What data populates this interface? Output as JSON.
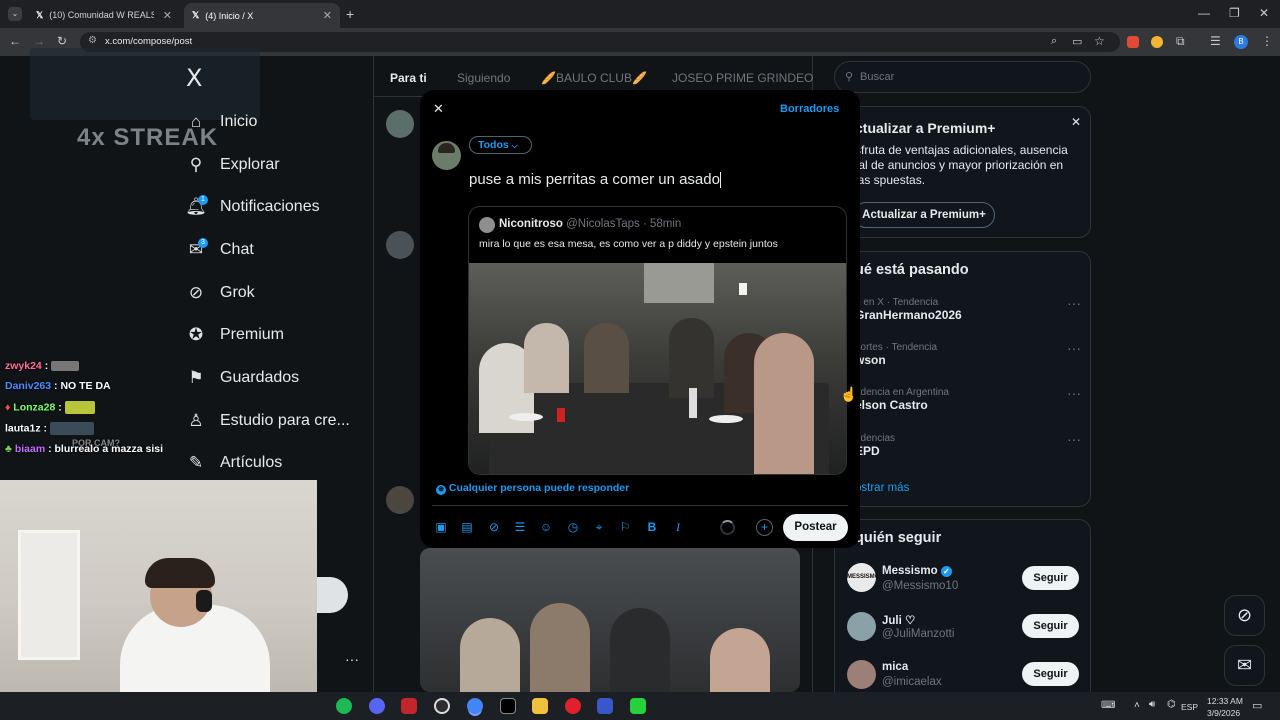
{
  "browser": {
    "tabs": [
      {
        "title": "(10) Comunidad W REALS 🔥 /",
        "active": false
      },
      {
        "title": "(4) Inicio / X",
        "active": true
      }
    ],
    "url": "x.com/compose/post",
    "profile_letter": "B"
  },
  "sidebar": {
    "logo": "X",
    "items": [
      {
        "label": "Inicio",
        "icon": "home-icon"
      },
      {
        "label": "Explorar",
        "icon": "search-icon"
      },
      {
        "label": "Notificaciones",
        "icon": "bell-icon",
        "badge": "1"
      },
      {
        "label": "Chat",
        "icon": "mail-icon",
        "badge": "3"
      },
      {
        "label": "Grok",
        "icon": "grok-icon"
      },
      {
        "label": "Premium",
        "icon": "verified-icon"
      },
      {
        "label": "Guardados",
        "icon": "bookmark-icon"
      },
      {
        "label": "Estudio para cre...",
        "icon": "studio-icon"
      },
      {
        "label": "Artículos",
        "icon": "article-icon"
      }
    ],
    "more_dots": "···"
  },
  "feed": {
    "tabs": [
      "Para ti",
      "Siguiendo",
      "🥖BAULO CLUB🥖",
      "JOSEO PRIME GRINDEO"
    ]
  },
  "right": {
    "search_placeholder": "Buscar",
    "premium": {
      "title": "ctualizar a Premium+",
      "body": "sfruta de ventajas adicionales, ausencia tal de anuncios y mayor priorización en las spuestas.",
      "button": "Actualizar a Premium+"
    },
    "trends": {
      "title": "ué está pasando",
      "items": [
        {
          "category": "o en X · Tendencia",
          "name": "GranHermano2026"
        },
        {
          "category": "portes · Tendencia",
          "name": "wson"
        },
        {
          "category": "ndencia en Argentina",
          "name": "elson Castro"
        },
        {
          "category": "ndencias",
          "name": "EPD"
        }
      ],
      "show_more": "ostrar más"
    },
    "who_to_follow": {
      "title": "quién seguir",
      "follow_label": "Seguir",
      "users": [
        {
          "name": "Messismo",
          "handle": "@Messismo10",
          "verified": true
        },
        {
          "name": "Juli ♡",
          "handle": "@JuliManzotti",
          "verified": false
        },
        {
          "name": "mica",
          "handle": "@imicaelax",
          "verified": false
        }
      ]
    }
  },
  "compose": {
    "close": "✕",
    "drafts": "Borradores",
    "audience": "Todos",
    "text": "puse a mis perritas a comer un asado",
    "quote": {
      "name": "Niconitroso",
      "handle": "@NicolasTaps",
      "time": "· 58min",
      "text": "mira lo que es esa mesa, es como ver a p diddy y epstein juntos"
    },
    "reply_setting": "Cualquier persona puede responder",
    "post_button": "Postear",
    "tools": [
      "image-icon",
      "gif-icon",
      "grok-icon",
      "poll-icon",
      "emoji-icon",
      "schedule-icon",
      "location-icon",
      "flag-icon",
      "bold-icon",
      "italic-icon"
    ]
  },
  "stream": {
    "streak": "4x STREAK",
    "chat": [
      {
        "user": "zwyk24",
        "sep": " :",
        "msg": "",
        "color": "#ff6f9a"
      },
      {
        "user": "Daniv263",
        "sep": " :",
        "msg": " NO TE DA",
        "color": "#4f8cff"
      },
      {
        "user": "Lonza28",
        "sep": " :",
        "msg": "",
        "color": "#7cff6b"
      },
      {
        "user": "lauta1z",
        "sep": " :",
        "msg": "",
        "color": "#ffffff"
      },
      {
        "user": "",
        "sep": "",
        "msg": "POR CAM?",
        "color": "#888888"
      },
      {
        "user": "biaam",
        "sep": " :",
        "msg": " blurrealo a mazza sisi",
        "color": "#c46bff"
      }
    ]
  },
  "taskbar": {
    "lang": "ESP",
    "time": "12:33 AM",
    "date": "3/9/2026"
  },
  "colors": {
    "accent": "#1d9bf0",
    "bg": "#101417",
    "border": "#2f3336"
  }
}
